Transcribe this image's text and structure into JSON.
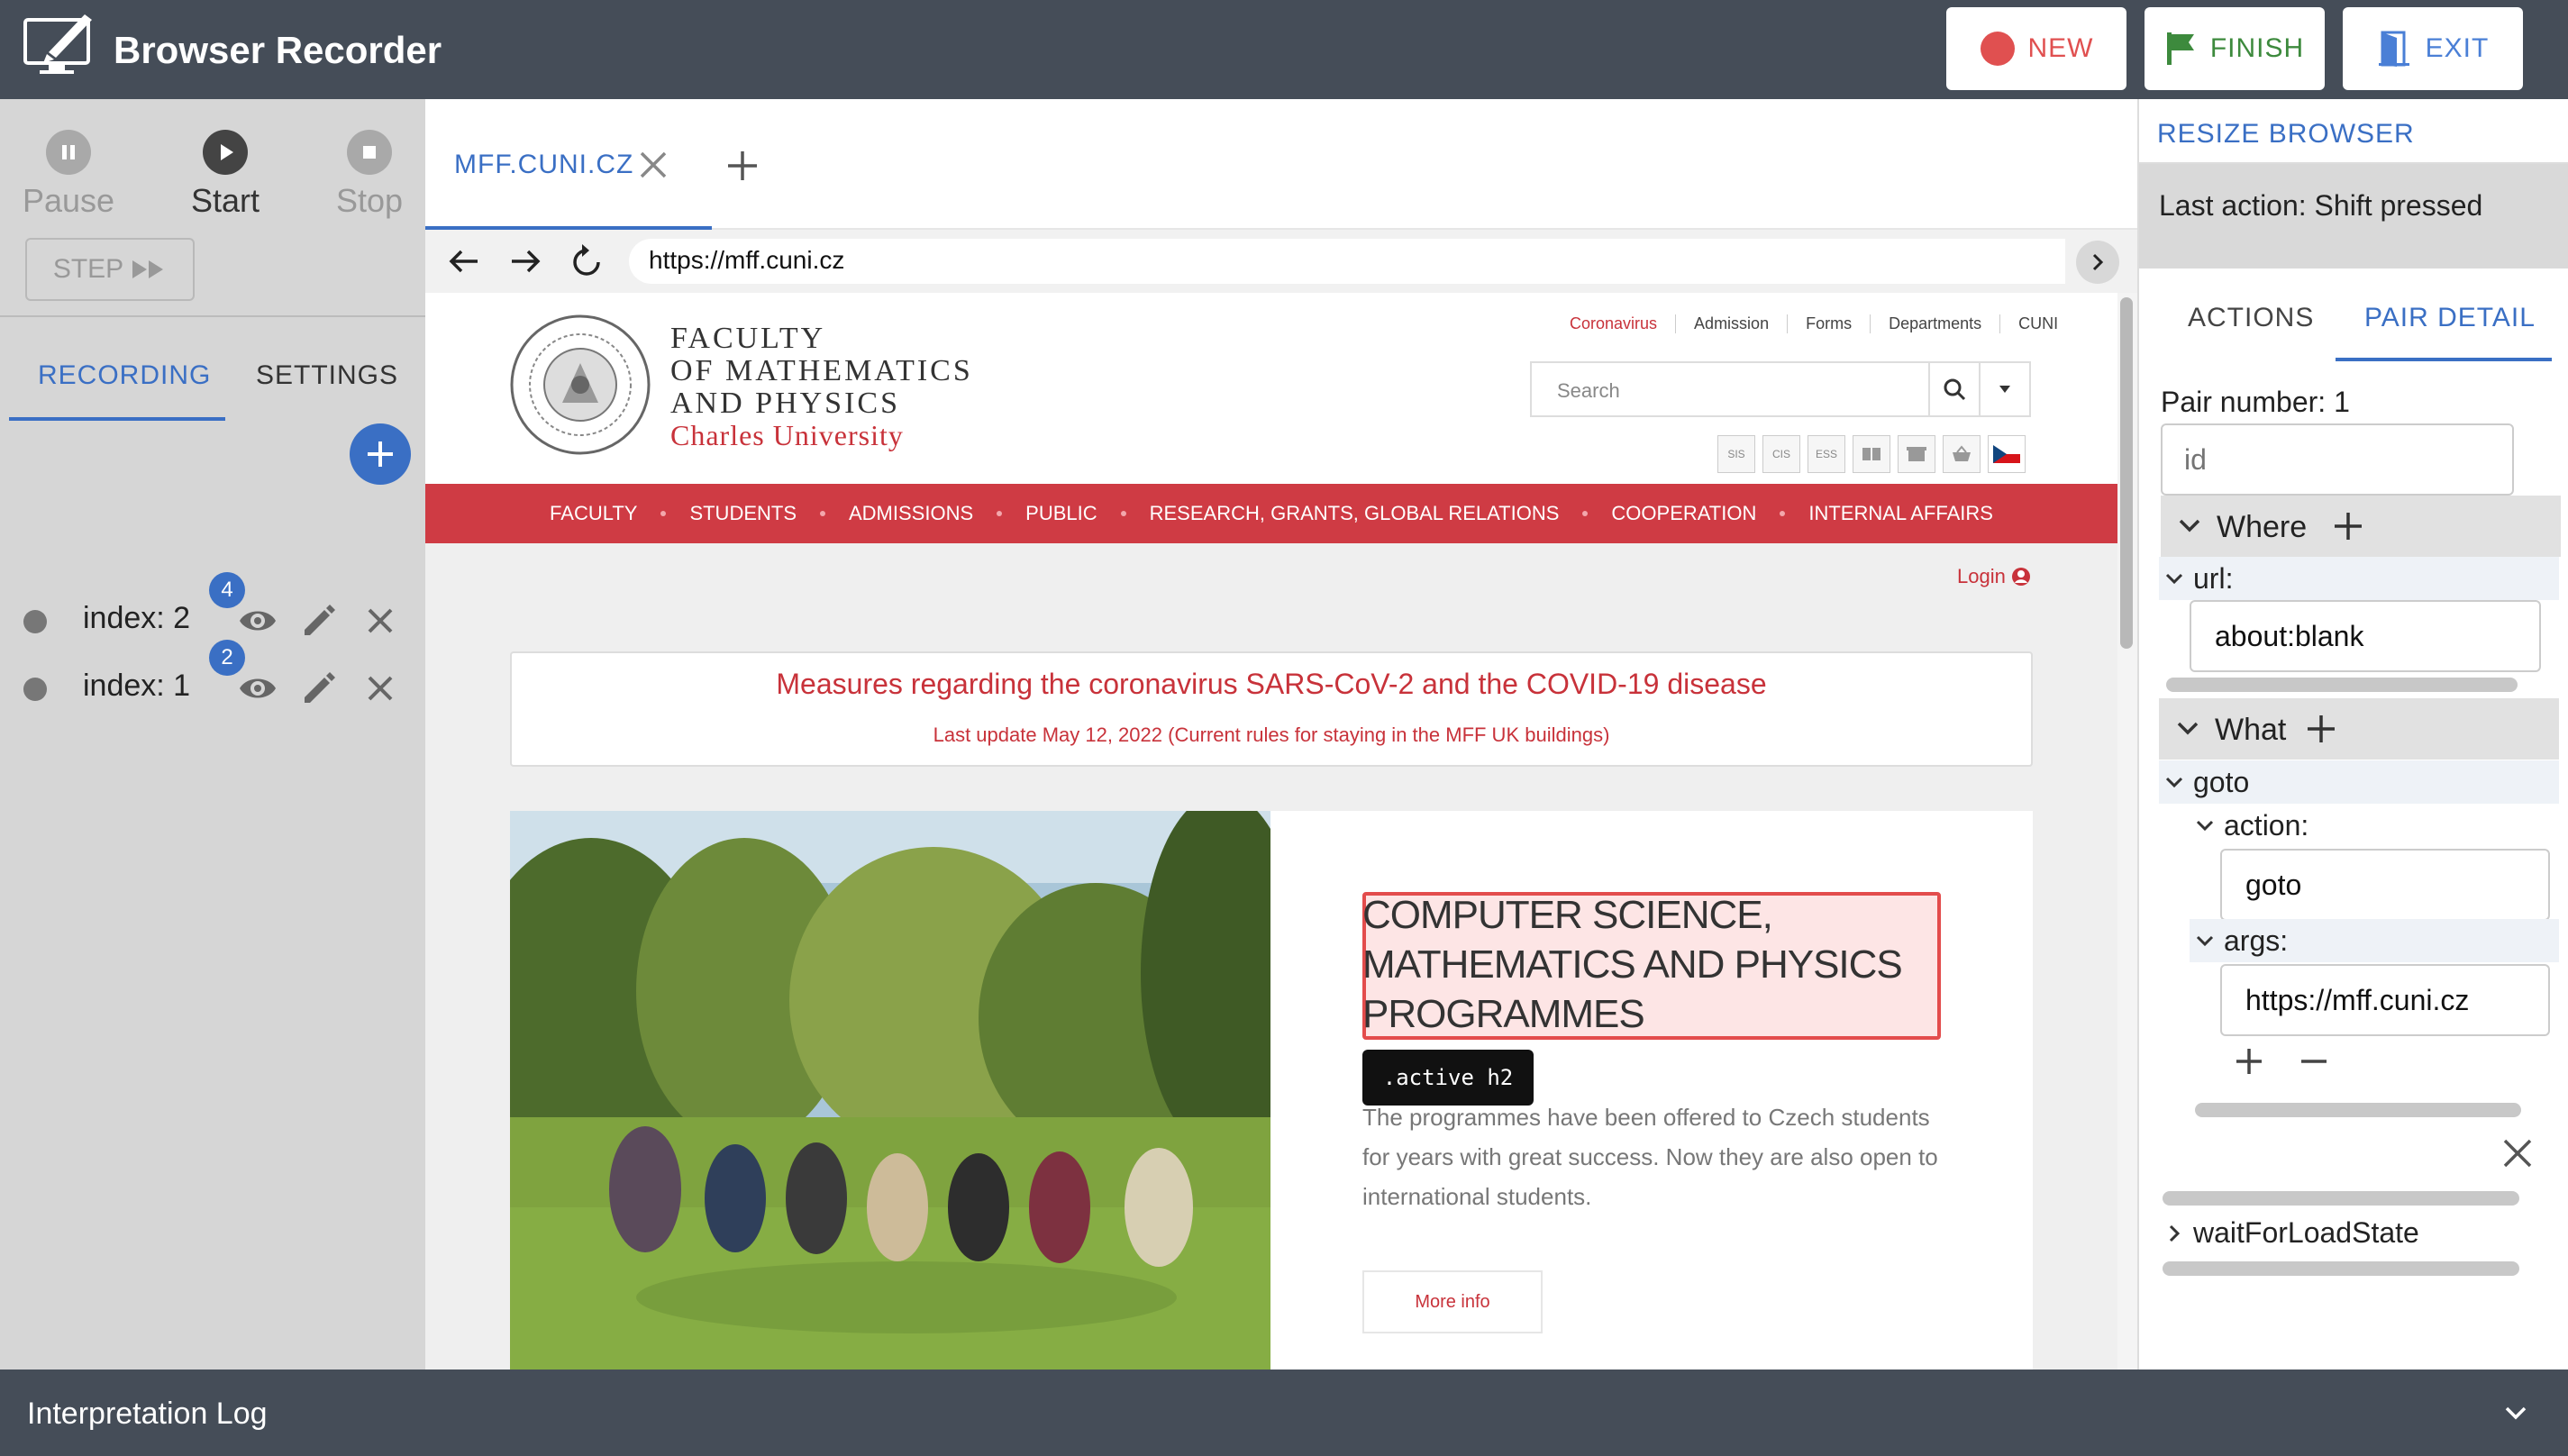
{
  "header": {
    "title": "Browser Recorder",
    "new_label": "NEW",
    "finish_label": "FINISH",
    "exit_label": "EXIT"
  },
  "controls": {
    "pause": "Pause",
    "start": "Start",
    "stop": "Stop",
    "step": "STEP"
  },
  "left_tabs": {
    "recording": "RECORDING",
    "settings": "SETTINGS"
  },
  "pairs": [
    {
      "label": "index: 2",
      "badge": "4"
    },
    {
      "label": "index: 1",
      "badge": "2"
    }
  ],
  "browser": {
    "tab_label": "MFF.CUNI.CZ",
    "url": "https://mff.cuni.cz"
  },
  "website": {
    "faculty_line1": "FACULTY",
    "faculty_line2": "OF MATHEMATICS",
    "faculty_line3": "AND PHYSICS",
    "university": "Charles University",
    "top_links": [
      "Coronavirus",
      "Admission",
      "Forms",
      "Departments",
      "CUNI"
    ],
    "search_placeholder": "Search",
    "sys_icons": [
      "SIS",
      "CIS",
      "ESS"
    ],
    "nav": [
      "FACULTY",
      "STUDENTS",
      "ADMISSIONS",
      "PUBLIC",
      "RESEARCH, GRANTS, GLOBAL RELATIONS",
      "COOPERATION",
      "INTERNAL AFFAIRS"
    ],
    "login": "Login",
    "covid_title": "Measures regarding the coronavirus SARS-CoV-2 and the COVID-19 disease",
    "covid_sub": "Last update May 12, 2022 (Current rules for staying in the MFF UK buildings)",
    "hero_title": "COMPUTER SCIENCE, MATHEMATICS AND PHYSICS PROGRAMMES",
    "tooltip": ".active h2",
    "hero_text": "The programmes have been offered to Czech students for years with great success. Now they are also open to international students.",
    "more_info": "More info"
  },
  "right_panel": {
    "resize_label": "RESIZE BROWSER",
    "last_action": "Last action: Shift pressed",
    "tab_actions": "ACTIONS",
    "tab_pair_detail": "PAIR DETAIL",
    "pair_number": "Pair number: 1",
    "id_placeholder": "id",
    "where_label": "Where",
    "url_label": "url:",
    "url_value": "about:blank",
    "what_label": "What",
    "goto_label": "goto",
    "action_label": "action:",
    "action_value": "goto",
    "args_label": "args:",
    "args_value": "https://mff.cuni.cz",
    "wait_label": "waitForLoadState"
  },
  "footer": {
    "log_title": "Interpretation Log"
  },
  "colors": {
    "accent": "#3a6fc4",
    "header_bg": "#454d58",
    "record_red": "#e05050",
    "finish_green": "#3d8a3d",
    "site_red": "#cf3b44"
  }
}
